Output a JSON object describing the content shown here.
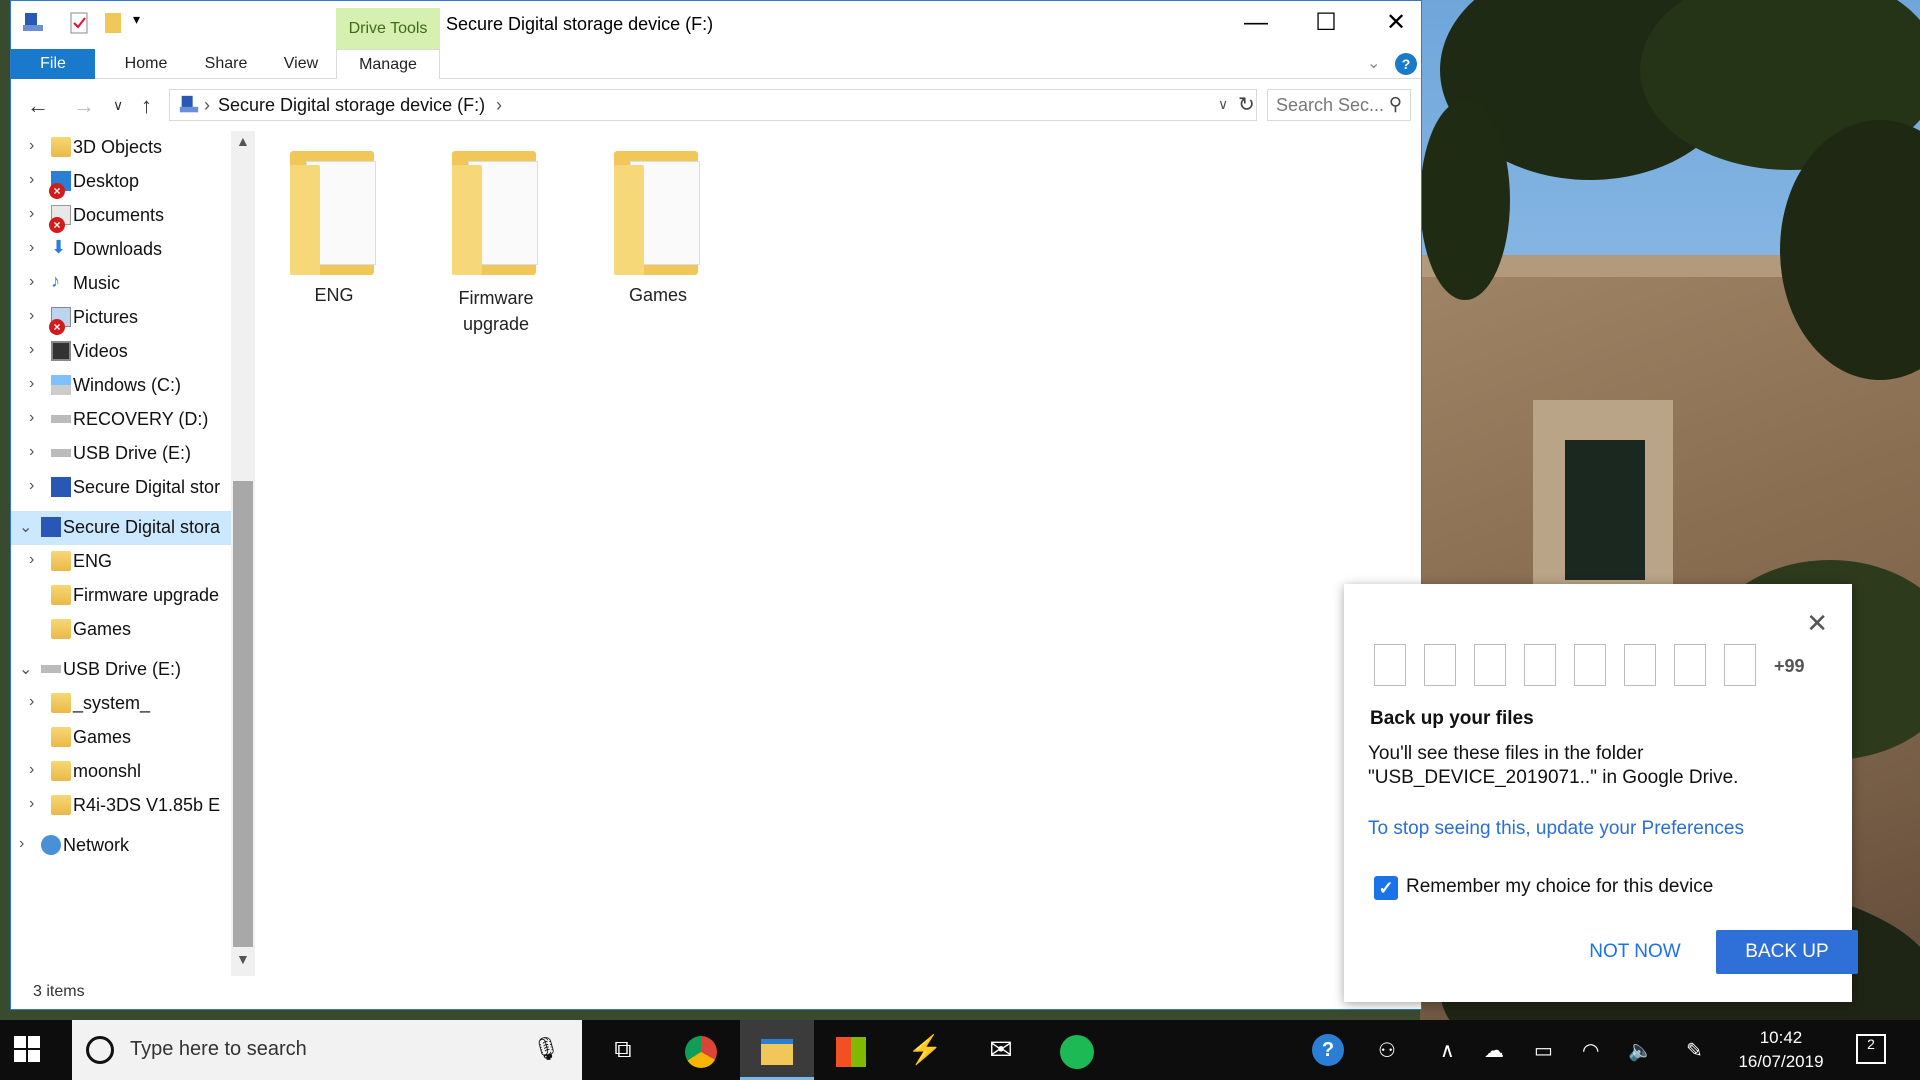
{
  "window": {
    "title": "Secure Digital storage device (F:)",
    "context_tab": "Drive Tools",
    "buttons": {
      "minimize": "—",
      "maximize": "☐",
      "close": "✕"
    }
  },
  "ribbon": {
    "tabs": [
      {
        "label": "File"
      },
      {
        "label": "Home"
      },
      {
        "label": "Share"
      },
      {
        "label": "View"
      },
      {
        "label": "Manage"
      }
    ]
  },
  "address": {
    "path": "Secure Digital storage device (F:)",
    "search_placeholder": "Search Sec..."
  },
  "nav": {
    "items": [
      {
        "label": "3D Objects"
      },
      {
        "label": "Desktop"
      },
      {
        "label": "Documents"
      },
      {
        "label": "Downloads"
      },
      {
        "label": "Music"
      },
      {
        "label": "Pictures"
      },
      {
        "label": "Videos"
      },
      {
        "label": "Windows (C:)"
      },
      {
        "label": "RECOVERY (D:)"
      },
      {
        "label": "USB Drive (E:)"
      },
      {
        "label": "Secure Digital stor"
      },
      {
        "label": "Secure Digital stora"
      },
      {
        "label": "ENG"
      },
      {
        "label": "Firmware upgrade"
      },
      {
        "label": "Games"
      },
      {
        "label": "USB Drive (E:)"
      },
      {
        "label": "_system_"
      },
      {
        "label": "Games"
      },
      {
        "label": "moonshl"
      },
      {
        "label": "R4i-3DS V1.85b E"
      },
      {
        "label": "Network"
      }
    ]
  },
  "content": {
    "folders": [
      {
        "label": "ENG"
      },
      {
        "label": "Firmware upgrade"
      },
      {
        "label": "Games"
      }
    ]
  },
  "status": {
    "items": "3 items"
  },
  "popup": {
    "more_count": "+99",
    "title": "Back up your files",
    "body": "You'll see these files in the folder \"USB_DEVICE_2019071..\" in Google Drive.",
    "link": "To stop seeing this, update your Preferences",
    "checkbox_label": "Remember my choice for this device",
    "checkbox_checked": true,
    "not_now": "NOT NOW",
    "back_up": "BACK UP",
    "accent_color": "#2f6fd8"
  },
  "taskbar": {
    "search_placeholder": "Type here to search",
    "time": "10:42",
    "date": "16/07/2019",
    "notification_count": "2"
  }
}
